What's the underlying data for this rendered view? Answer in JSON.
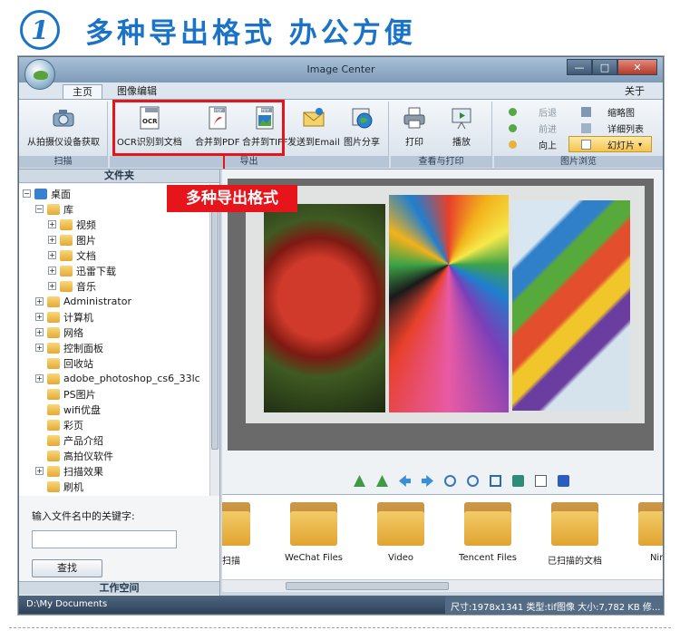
{
  "headline": {
    "number": "1",
    "text": "多种导出格式  办公方便"
  },
  "window": {
    "title": "Image Center",
    "controls": {
      "minimize": "—",
      "maximize": "□",
      "close": "✕"
    }
  },
  "tabs": {
    "home": "主页",
    "edit": "图像编辑",
    "about": "关于"
  },
  "ribbon": {
    "capture": {
      "button": "从拍摄仪设备获取",
      "group": "扫描"
    },
    "export": {
      "ocr": "OCR识别到文档",
      "pdf": "合并到PDF",
      "tiff": "合并到TIFF",
      "email": "发送到Email",
      "share": "图片分享",
      "group": "导出",
      "icon_labels": {
        "ocr": "OCR",
        "pdf": "PDF",
        "tiff": "TIFF"
      }
    },
    "print": {
      "print": "打印",
      "play": "播放",
      "group": "查看与打印"
    },
    "browse": {
      "back": "后退",
      "forward": "前进",
      "up": "向上",
      "thumbnail": "缩略图",
      "details": "详细列表",
      "slideshow": "幻灯片",
      "group": "图片浏览"
    }
  },
  "callout": "多种导出格式",
  "folder_pane": {
    "header": "文件夹",
    "items": [
      {
        "label": "桌面",
        "level": 0,
        "toggle": "⊟"
      },
      {
        "label": "库",
        "level": 1,
        "toggle": "⊟"
      },
      {
        "label": "视频",
        "level": 2,
        "toggle": "⊞"
      },
      {
        "label": "图片",
        "level": 2,
        "toggle": "⊞"
      },
      {
        "label": "文档",
        "level": 2,
        "toggle": "⊞"
      },
      {
        "label": "迅雷下载",
        "level": 2,
        "toggle": "⊞"
      },
      {
        "label": "音乐",
        "level": 2,
        "toggle": "⊞"
      },
      {
        "label": "Administrator",
        "level": 1,
        "toggle": "⊞"
      },
      {
        "label": "计算机",
        "level": 1,
        "toggle": "⊞"
      },
      {
        "label": "网络",
        "level": 1,
        "toggle": "⊞"
      },
      {
        "label": "控制面板",
        "level": 1,
        "toggle": "⊞"
      },
      {
        "label": "回收站",
        "level": 1,
        "toggle": ""
      },
      {
        "label": "adobe_photoshop_cs6_33lc",
        "level": 1,
        "toggle": "⊞"
      },
      {
        "label": "PS图片",
        "level": 1,
        "toggle": ""
      },
      {
        "label": "wifi优盘",
        "level": 1,
        "toggle": ""
      },
      {
        "label": "彩页",
        "level": 1,
        "toggle": ""
      },
      {
        "label": "产品介绍",
        "level": 1,
        "toggle": ""
      },
      {
        "label": "高拍仪软件",
        "level": 1,
        "toggle": ""
      },
      {
        "label": "扫描效果",
        "level": 1,
        "toggle": "⊞"
      },
      {
        "label": "刷机",
        "level": 1,
        "toggle": ""
      }
    ],
    "search_label": "输入文件名中的关键字:",
    "search_value": "",
    "search_button": "查找",
    "workspace": "工作空间"
  },
  "thumbnails": [
    {
      "label": "的扫描"
    },
    {
      "label": "WeChat Files"
    },
    {
      "label": "Video"
    },
    {
      "label": "Tencent Files"
    },
    {
      "label": "已扫描的文档"
    },
    {
      "label": "Nimo"
    }
  ],
  "status": {
    "path": "D:\\My Documents",
    "info": "尺寸:1978x1341 类型:tif图像 大小:7,782 KB 修..."
  },
  "colors": {
    "accent_blue": "#1b73c8",
    "highlight_red": "#e5151b"
  }
}
